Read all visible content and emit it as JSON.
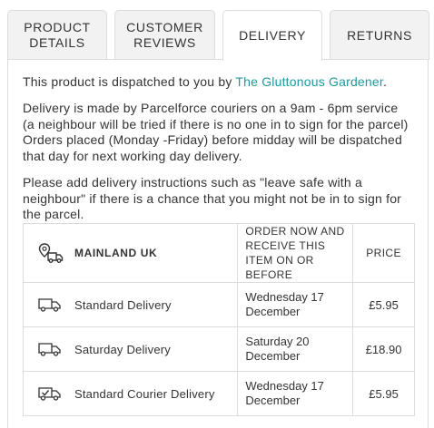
{
  "tabs": [
    {
      "label_line1": "PRODUCT",
      "label_line2": "DETAILS"
    },
    {
      "label_line1": "CUSTOMER",
      "label_line2": "REVIEWS"
    },
    {
      "label": "DELIVERY"
    },
    {
      "label": "RETURNS"
    }
  ],
  "intro": {
    "prefix": "This product is dispatched to you by ",
    "seller_link": "The Gluttonous Gardener",
    "suffix": "."
  },
  "delivery_info": "Delivery is made by Parcelforce couriers on a 9am - 6pm service (a neighbour will be tried if there is no one in to sign for the parcel) Orders placed (Monday -Friday) before midday will be dispatched that day for next working day delivery.",
  "instructions": "Please add delivery instructions such as \"leave safe with a neighbour\" if there is a chance that you might not be in to sign for the parcel.",
  "table": {
    "region": "MAINLAND UK",
    "region_icon": "map-pin-van-icon",
    "col_order": "ORDER NOW AND RECEIVE THIS ITEM ON OR BEFORE",
    "col_price": "PRICE",
    "rows": [
      {
        "service": "Standard Delivery",
        "icon": "van-icon",
        "date": "Wednesday 17 December",
        "price": "£5.95"
      },
      {
        "service": "Saturday Delivery",
        "icon": "van-icon",
        "date": "Saturday 20 December",
        "price": "£18.90"
      },
      {
        "service": "Standard Courier Delivery",
        "icon": "van-check-icon",
        "date": "Wednesday 17 December",
        "price": "£5.95"
      }
    ]
  },
  "colors": {
    "link": "#1c9aa0",
    "border": "#dcdcdc",
    "tab_bg": "#f2f2f2"
  }
}
